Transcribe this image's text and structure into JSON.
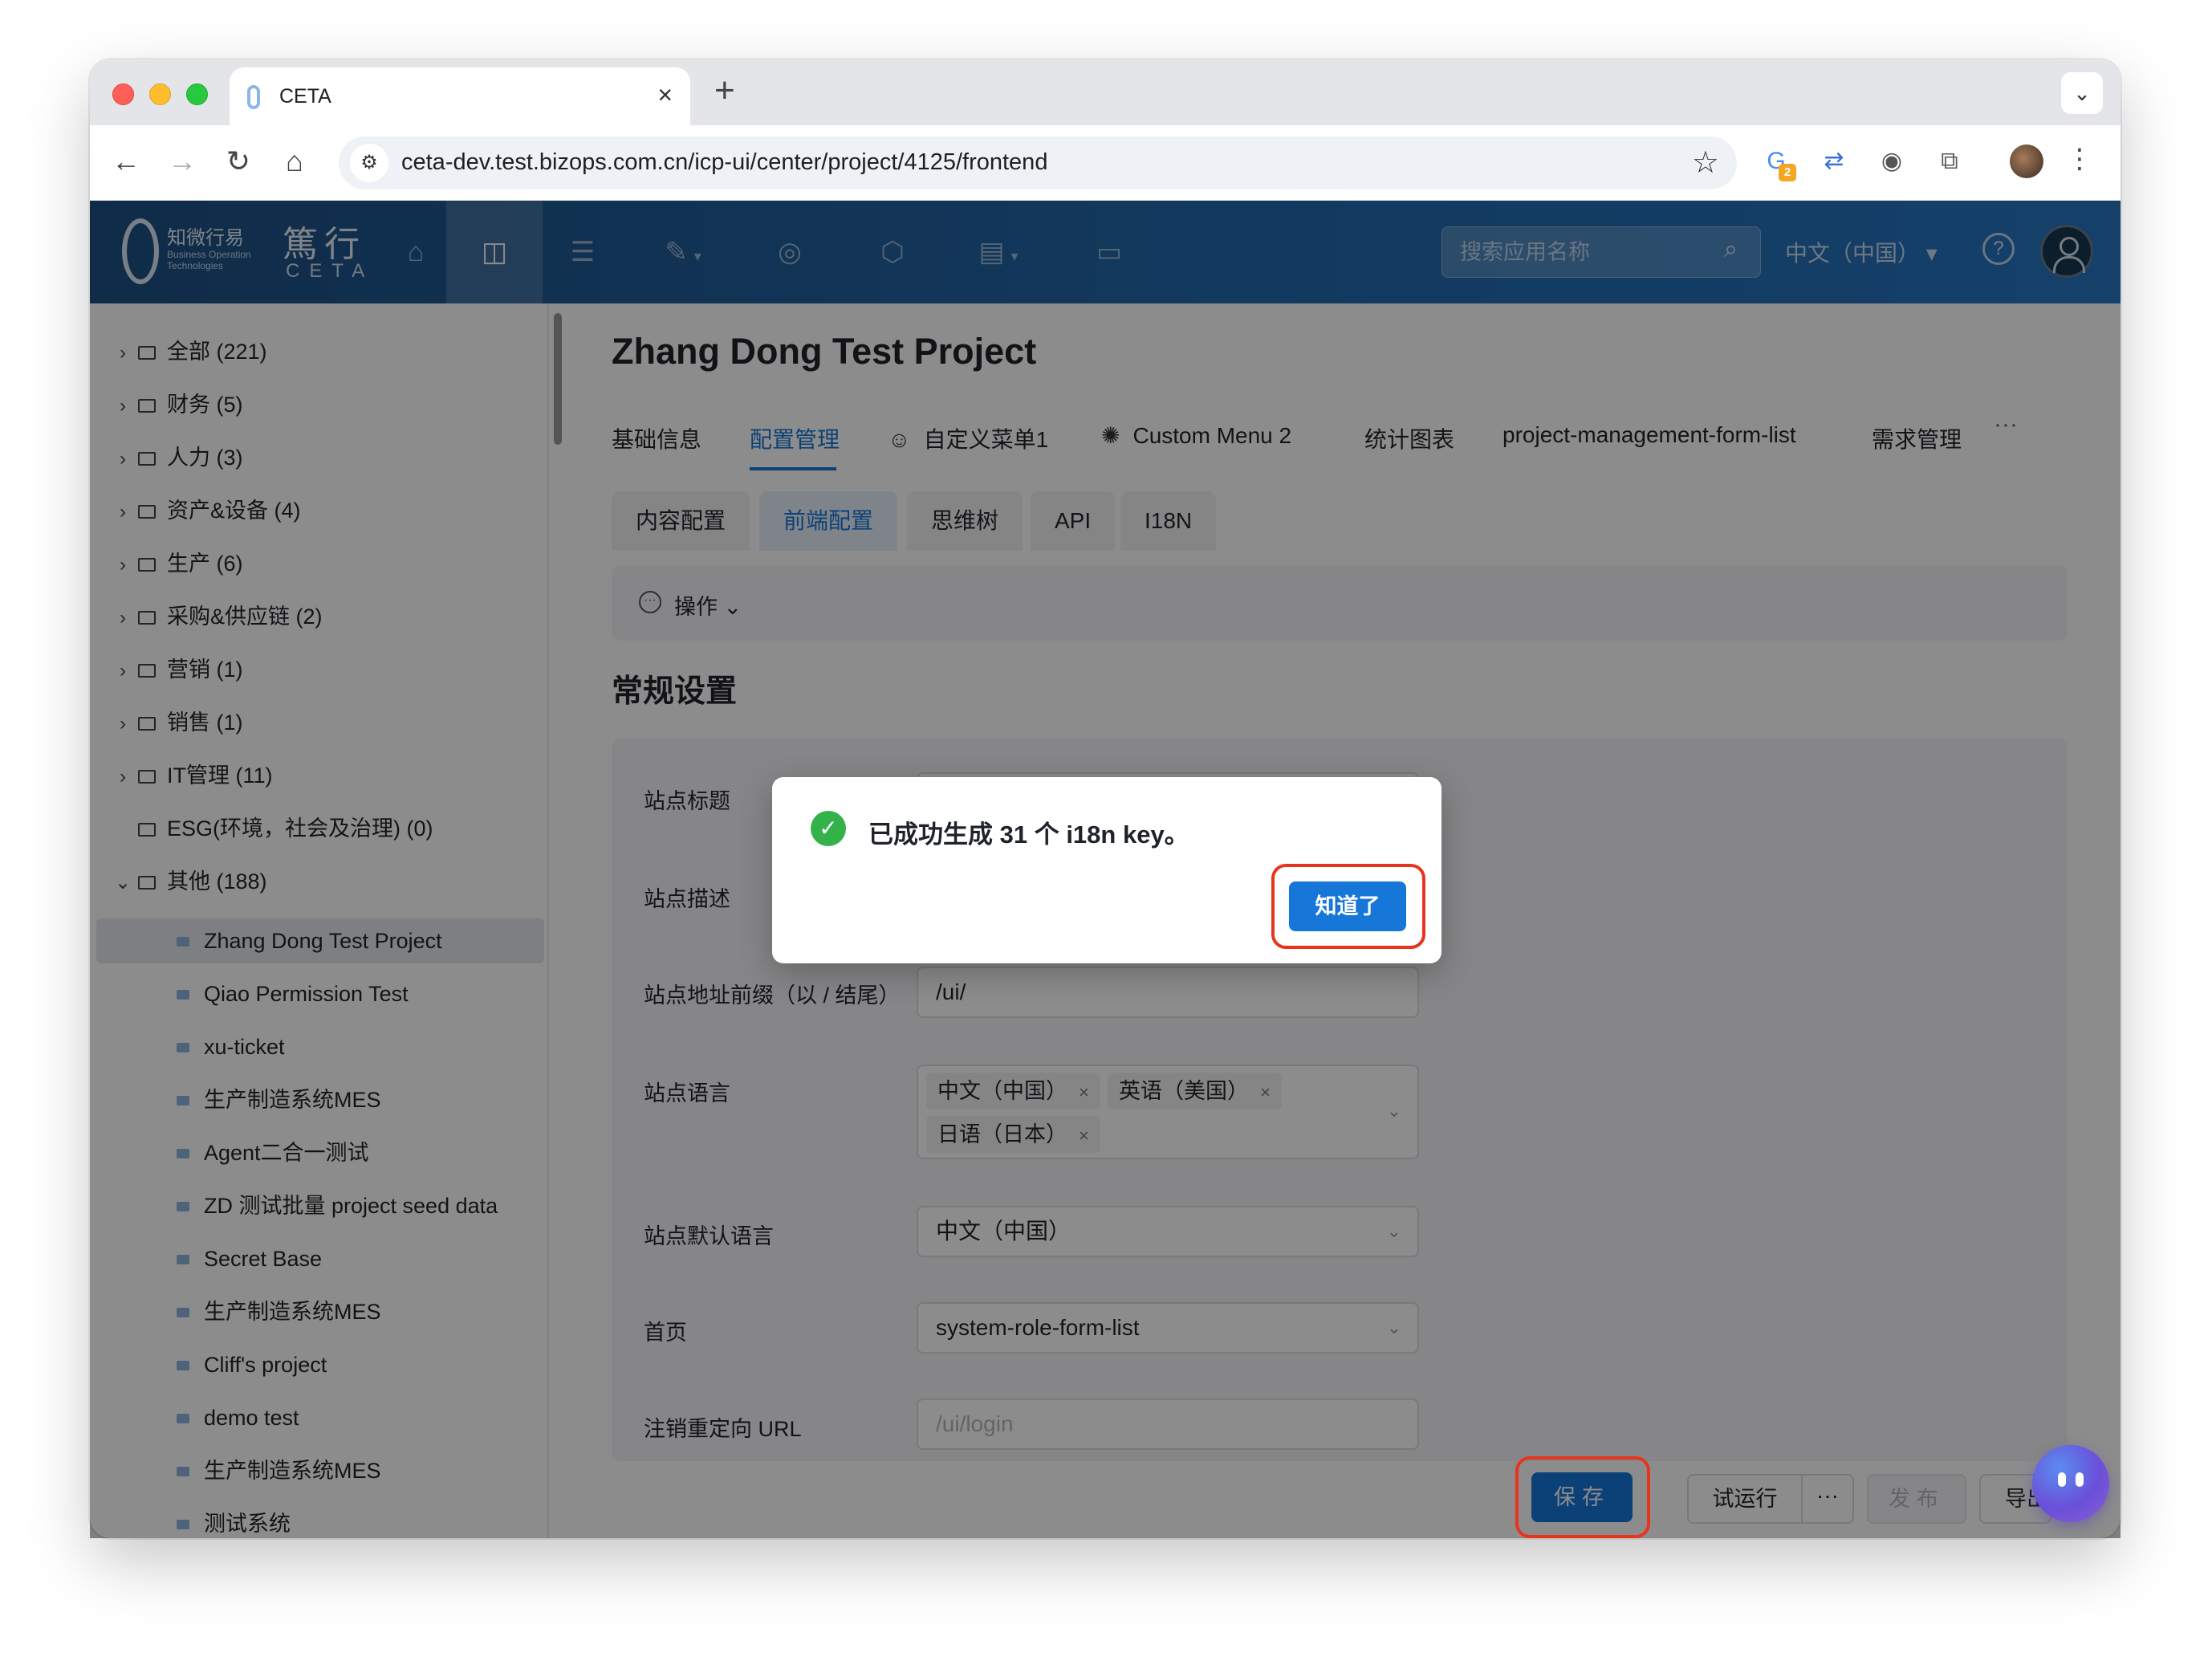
{
  "browser": {
    "tab_title": "CETA",
    "url": "ceta-dev.test.bizops.com.cn/icp-ui/center/project/4125/frontend",
    "extension_badge": "2"
  },
  "app_header": {
    "logo_cn": "知微行易",
    "logo_en": "Business Operation Technologies",
    "brand_cn": "篤行",
    "brand_en": "CETA",
    "search_placeholder": "搜索应用名称",
    "language": "中文（中国）"
  },
  "sidebar": {
    "categories": [
      {
        "label": "全部 (221)"
      },
      {
        "label": "财务 (5)"
      },
      {
        "label": "人力 (3)"
      },
      {
        "label": "资产&设备 (4)"
      },
      {
        "label": "生产 (6)"
      },
      {
        "label": "采购&供应链 (2)"
      },
      {
        "label": "营销 (1)"
      },
      {
        "label": "销售 (1)"
      },
      {
        "label": "IT管理 (11)"
      },
      {
        "label": "ESG(环境，社会及治理) (0)"
      },
      {
        "label": "其他 (188)"
      }
    ],
    "projects": [
      {
        "label": "Zhang Dong Test Project"
      },
      {
        "label": "Qiao Permission Test"
      },
      {
        "label": "xu-ticket"
      },
      {
        "label": "生产制造系统MES"
      },
      {
        "label": "Agent二合一测试"
      },
      {
        "label": "ZD 测试批量 project seed data"
      },
      {
        "label": "Secret Base"
      },
      {
        "label": "生产制造系统MES"
      },
      {
        "label": "Cliff's project"
      },
      {
        "label": "demo test"
      },
      {
        "label": "生产制造系统MES"
      },
      {
        "label": "测试系统"
      }
    ]
  },
  "main": {
    "project_title": "Zhang Dong Test Project",
    "primary_tabs": [
      {
        "label": "基础信息"
      },
      {
        "label": "配置管理"
      },
      {
        "label": "自定义菜单1"
      },
      {
        "label": "Custom Menu 2"
      },
      {
        "label": "统计图表"
      },
      {
        "label": "project-management-form-list"
      },
      {
        "label": "需求管理"
      }
    ],
    "more": "···",
    "secondary_tabs": [
      {
        "label": "内容配置"
      },
      {
        "label": "前端配置"
      },
      {
        "label": "思维树"
      },
      {
        "label": "API"
      },
      {
        "label": "I18N"
      }
    ],
    "operations_label": "操作",
    "section_title": "常规设置",
    "form": {
      "site_title_label": "站点标题",
      "site_desc_label": "站点描述",
      "url_prefix_label": "站点地址前缀（以 / 结尾）",
      "url_prefix_value": "/ui/",
      "languages_label": "站点语言",
      "languages": [
        "中文（中国）",
        "英语（美国）",
        "日语（日本）"
      ],
      "default_language_label": "站点默认语言",
      "default_language_value": "中文（中国）",
      "homepage_label": "首页",
      "homepage_value": "system-role-form-list",
      "logout_redirect_label": "注销重定向 URL",
      "logout_redirect_placeholder": "/ui/login"
    },
    "footer": {
      "save": "保存",
      "trial_run": "试运行",
      "more": "···",
      "publish": "发布",
      "export": "导出"
    }
  },
  "dialog": {
    "message": "已成功生成 31 个 i18n key。",
    "ok": "知道了"
  }
}
